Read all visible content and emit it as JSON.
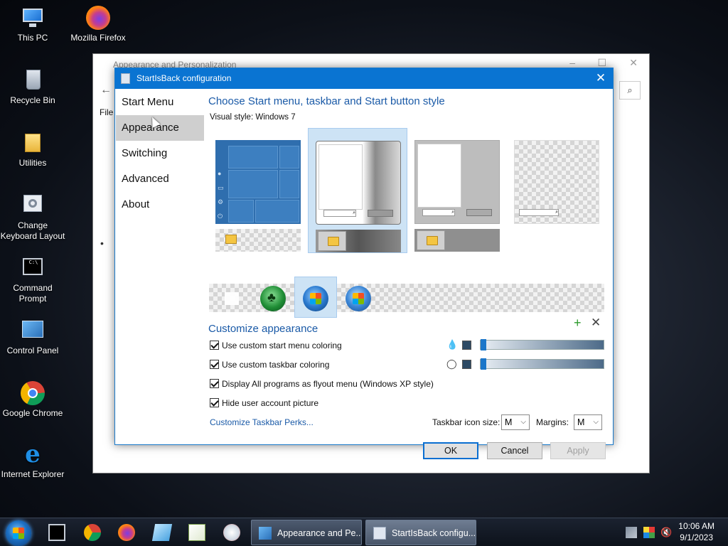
{
  "desktop": {
    "icons": [
      {
        "label": "This PC"
      },
      {
        "label": "Mozilla Firefox"
      },
      {
        "label": "Recycle Bin"
      },
      {
        "label": "Utilities"
      },
      {
        "label": "Change Keyboard Layout"
      },
      {
        "label": "Command Prompt"
      },
      {
        "label": "Control Panel"
      },
      {
        "label": "Google Chrome"
      },
      {
        "label": "Internet Explorer"
      }
    ]
  },
  "background_window": {
    "title": "Appearance and Personalization",
    "menu_file": "File",
    "back_icon": "arrow-left-icon",
    "search_icon": "search-icon"
  },
  "dialog": {
    "title": "StartIsBack configuration",
    "nav": [
      "Start Menu",
      "Appearance",
      "Switching",
      "Advanced",
      "About"
    ],
    "active_nav": "Appearance",
    "heading": "Choose Start menu, taskbar and Start button style",
    "visual_style_label": "Visual style:",
    "visual_style_value": "Windows 7",
    "customize_heading": "Customize appearance",
    "options": [
      {
        "label": "Use custom start menu coloring",
        "checked": true
      },
      {
        "label": "Use custom taskbar coloring",
        "checked": true
      },
      {
        "label": "Display All programs as flyout menu (Windows XP style)",
        "checked": true
      },
      {
        "label": "Hide user account picture",
        "checked": true
      }
    ],
    "perks_link": "Customize Taskbar Perks...",
    "taskbar_icon_size_label": "Taskbar icon size:",
    "taskbar_icon_size_value": "M",
    "margins_label": "Margins:",
    "margins_value": "M",
    "buttons": {
      "ok": "OK",
      "cancel": "Cancel",
      "apply": "Apply"
    },
    "colors": {
      "accent": "#0a74d2",
      "heading": "#1a5aa7",
      "swatch": "#2d4a64"
    }
  },
  "taskbar": {
    "pinned": [
      "command-prompt-icon",
      "chrome-icon",
      "firefox-icon",
      "notepad-icon",
      "notepad-plus-icon",
      "paint-icon"
    ],
    "windows": [
      {
        "label": "Appearance and Pe..."
      },
      {
        "label": "StartIsBack configu..."
      }
    ],
    "clock_time": "10:06 AM",
    "clock_date": "9/1/2023"
  }
}
